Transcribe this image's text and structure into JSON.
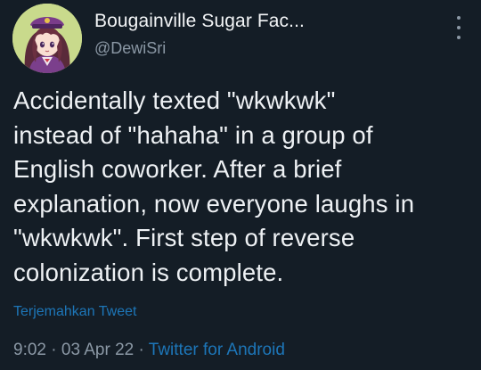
{
  "tweet": {
    "display_name": "Bougainville Sugar Fac...",
    "handle": "@DewiSri",
    "text": "Accidentally texted \"wkwkwk\"\ninstead of \"hahaha\" in a group of\nEnglish coworker. After a brief\nexplanation, now everyone laughs in\n\"wkwkwk\". First step of reverse\ncolonization is complete.",
    "translate_label": "Terjemahkan Tweet",
    "time": "9:02",
    "separator": "·",
    "date": "03 Apr 22",
    "source": "Twitter for Android"
  },
  "icons": {
    "avatar": "anime-girl-avatar",
    "more": "more-vertical-icon"
  },
  "colors": {
    "background": "#141d26",
    "text": "#eef1f4",
    "secondary": "#8b98a5",
    "link": "#1d76b8"
  }
}
